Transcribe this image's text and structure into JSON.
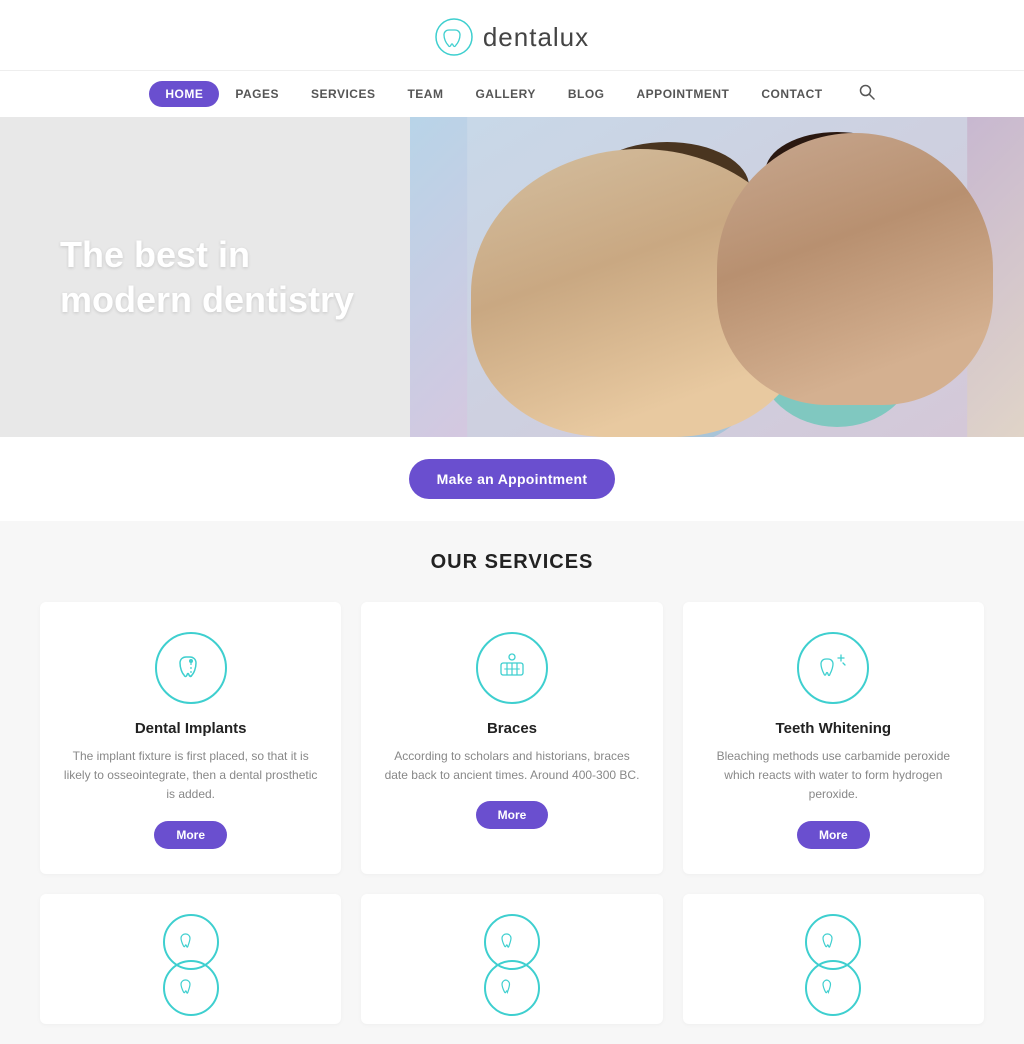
{
  "brand": {
    "name": "dentalux",
    "logoAlt": "Dentalux Logo"
  },
  "nav": {
    "items": [
      {
        "label": "HOME",
        "active": true
      },
      {
        "label": "PAGES",
        "active": false
      },
      {
        "label": "SERVICES",
        "active": false
      },
      {
        "label": "TEAM",
        "active": false
      },
      {
        "label": "GALLERY",
        "active": false
      },
      {
        "label": "BLOG",
        "active": false
      },
      {
        "label": "APPOINTMENT",
        "active": false
      },
      {
        "label": "CONTACT",
        "active": false
      }
    ]
  },
  "hero": {
    "title": "The best in modern dentistry",
    "cta": "Make an Appointment"
  },
  "services": {
    "sectionTitle": "OUR SERVICES",
    "cards": [
      {
        "id": "dental-implants",
        "name": "Dental Implants",
        "desc": "The implant fixture is first placed, so that it is likely to osseointegrate, then a dental prosthetic is added.",
        "more": "More"
      },
      {
        "id": "braces",
        "name": "Braces",
        "desc": "According to scholars and historians, braces date back to ancient times. Around 400-300 BC.",
        "more": "More"
      },
      {
        "id": "teeth-whitening",
        "name": "Teeth Whitening",
        "desc": "Bleaching methods use carbamide peroxide which reacts with water to form hydrogen peroxide.",
        "more": "More"
      }
    ],
    "bottomCards": [
      {
        "id": "service-4"
      },
      {
        "id": "service-5"
      },
      {
        "id": "service-6"
      }
    ]
  },
  "colors": {
    "accent": "#6a4fcf",
    "teal": "#3ecfcf",
    "textDark": "#222222",
    "textMid": "#555555",
    "textLight": "#888888"
  }
}
